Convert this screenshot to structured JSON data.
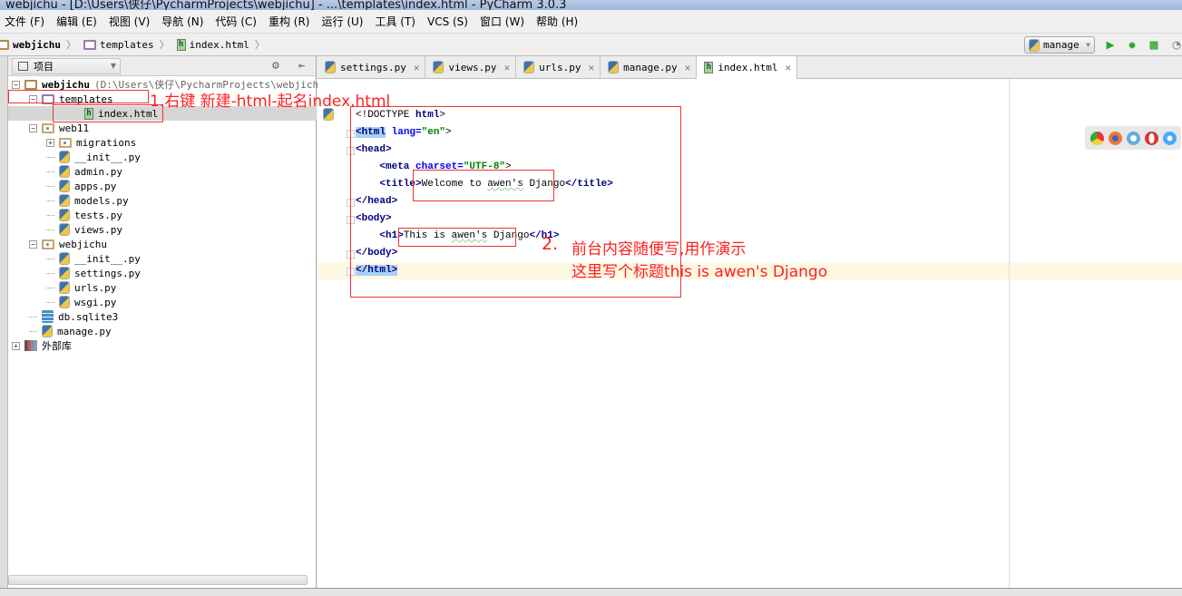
{
  "window": {
    "title": "webjichu - [D:\\Users\\侠仔\\PycharmProjects\\webjichu] - ...\\templates\\index.html - PyCharm 3.0.3"
  },
  "menu": [
    "文件 (F)",
    "编辑 (E)",
    "视图 (V)",
    "导航 (N)",
    "代码 (C)",
    "重构 (R)",
    "运行 (U)",
    "工具 (T)",
    "VCS (S)",
    "窗口 (W)",
    "帮助 (H)"
  ],
  "breadcrumb": [
    "webjichu",
    "templates",
    "index.html"
  ],
  "run_config": "manage",
  "project_panel": {
    "selector": "项目",
    "tree": [
      {
        "label": "webjichu",
        "extra": "(D:\\Users\\侠仔\\PycharmProjects\\webjichu)",
        "level": 0,
        "icon": "folder",
        "expander": "-",
        "bold": true
      },
      {
        "label": "templates",
        "level": 1,
        "icon": "folder-purple",
        "expander": "-"
      },
      {
        "label": "index.html",
        "level": 2,
        "icon": "html",
        "selected": true
      },
      {
        "label": "web11",
        "level": 1,
        "icon": "module",
        "expander": "-"
      },
      {
        "label": "migrations",
        "level": 2,
        "icon": "module",
        "expander": "+"
      },
      {
        "label": "__init__.py",
        "level": 2,
        "icon": "python"
      },
      {
        "label": "admin.py",
        "level": 2,
        "icon": "python"
      },
      {
        "label": "apps.py",
        "level": 2,
        "icon": "python"
      },
      {
        "label": "models.py",
        "level": 2,
        "icon": "python"
      },
      {
        "label": "tests.py",
        "level": 2,
        "icon": "python"
      },
      {
        "label": "views.py",
        "level": 2,
        "icon": "python"
      },
      {
        "label": "webjichu",
        "level": 1,
        "icon": "module",
        "expander": "-"
      },
      {
        "label": "__init__.py",
        "level": 2,
        "icon": "python"
      },
      {
        "label": "settings.py",
        "level": 2,
        "icon": "python"
      },
      {
        "label": "urls.py",
        "level": 2,
        "icon": "python"
      },
      {
        "label": "wsgi.py",
        "level": 2,
        "icon": "python"
      },
      {
        "label": "db.sqlite3",
        "level": 1,
        "icon": "database"
      },
      {
        "label": "manage.py",
        "level": 1,
        "icon": "python"
      },
      {
        "label": "外部库",
        "level": 0,
        "icon": "library",
        "expander": "+"
      }
    ]
  },
  "tabs": [
    {
      "label": "settings.py",
      "icon": "python"
    },
    {
      "label": "views.py",
      "icon": "python"
    },
    {
      "label": "urls.py",
      "icon": "python"
    },
    {
      "label": "manage.py",
      "icon": "python"
    },
    {
      "label": "index.html",
      "icon": "html",
      "active": true
    }
  ],
  "code": {
    "l1a": "<!DOCTYPE ",
    "l1b": "html",
    "l1c": ">",
    "l2a": "<html",
    "l2b": " lang=",
    "l2c": "\"en\"",
    "l2d": ">",
    "l3": "<head>",
    "l4a": "    <meta ",
    "l4b": "charset=",
    "l4c": "\"UTF-8\"",
    "l4d": ">",
    "l5a": "    <title>",
    "l5b": "Welcome to ",
    "l5c": "awen's",
    "l5d": " Django",
    "l5e": "</title>",
    "l6": "</head>",
    "l7": "<body>",
    "l8a": "    <h1>",
    "l8b": "This is ",
    "l8c": "awen's",
    "l8d": " Django",
    "l8e": "</h1>",
    "l9": "</body>",
    "l10": "</html>"
  },
  "annotations": {
    "a1": "1.右键 新建-html-起名index.html",
    "a2num": "2.",
    "a2line1": "前台内容随便写,用作演示",
    "a2line2": "这里写个标题this is awen's Django"
  },
  "colors": {
    "annotation": "#ff2020",
    "tag": "#000080",
    "string": "#008000"
  }
}
